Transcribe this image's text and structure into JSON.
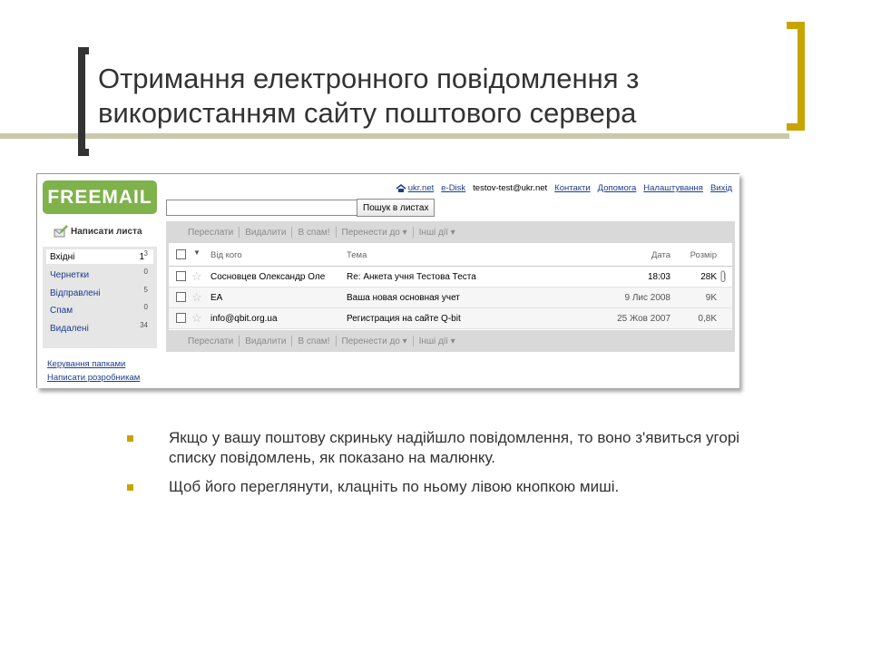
{
  "slide": {
    "title": "Отримання електронного повідомлення з використанням сайту поштового сервера",
    "bullets": [
      "Якщо у вашу поштову скриньку надійшло повідомлення, то воно з'явиться угорі списку повідомлень, як показано на малюнку.",
      "Щоб його переглянути, клацніть по ньому лівою кнопкою миші."
    ],
    "accent_color": "#c8a400"
  },
  "mail": {
    "logo": "FREEMAIL",
    "topnav": {
      "ukrnet": "ukr.net",
      "edisk": "e-Disk",
      "user": "testov-test@ukr.net",
      "contacts": "Контакти",
      "help": "Допомога",
      "settings": "Налаштування",
      "exit": "Вихід"
    },
    "search": {
      "value": "",
      "button": "Пошук в листах"
    },
    "compose": "Написати листа",
    "folders": [
      {
        "name": "Вхідні",
        "unread": "1",
        "count": "3"
      },
      {
        "name": "Чернетки",
        "count": "0"
      },
      {
        "name": "Відправлені",
        "count": "5"
      },
      {
        "name": "Спам",
        "count": "0"
      },
      {
        "name": "Видалені",
        "count": "34"
      }
    ],
    "sidelinks": {
      "manage": "Керування папками",
      "write_devs": "Написати розробникам"
    },
    "toolbar": {
      "forward": "Переслати",
      "delete": "Видалити",
      "spam": "В спам!",
      "move": "Перенести до",
      "other": "Інші дії"
    },
    "columns": {
      "from": "Від кого",
      "subject": "Тема",
      "date": "Дата",
      "size": "Розмір"
    },
    "messages": [
      {
        "from": "Сосновцев Олександр Оле",
        "subject": "Re: Анкета учня Тестова Теста",
        "date": "18:03",
        "size": "28K",
        "attachment": true
      },
      {
        "from": "EA",
        "subject": "Ваша новая основная учет",
        "date": "9 Лис 2008",
        "size": "9K"
      },
      {
        "from": "info@qbit.org.ua",
        "subject": "Регистрация на сайте Q-bit",
        "date": "25 Жов 2007",
        "size": "0,8K"
      }
    ],
    "brand_color": "#7fb24b"
  }
}
